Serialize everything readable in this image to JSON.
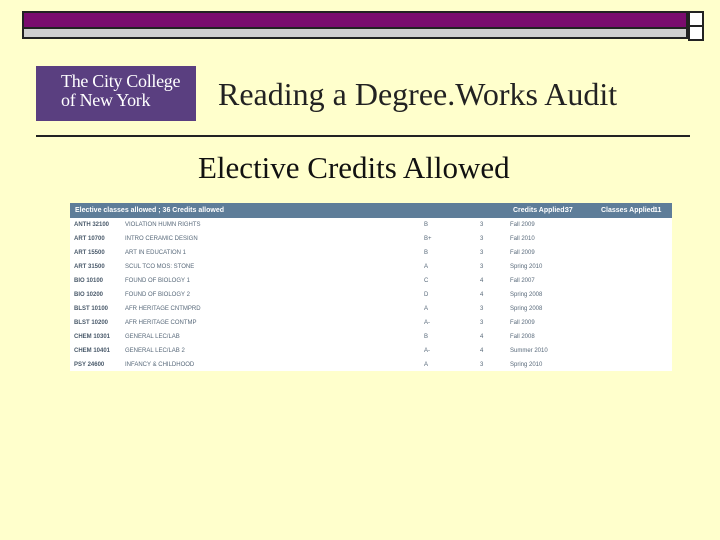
{
  "slide": {
    "title": "Reading a Degree.Works Audit",
    "subtitle": "Elective Credits Allowed"
  },
  "logo": {
    "line1": "The City College",
    "line2": "of New York"
  },
  "audit": {
    "header_label": "Elective classes allowed ; 36 Credits allowed",
    "credits_applied_label": "Credits Applied:",
    "credits_applied_value": "37",
    "classes_applied_label": "Classes Applied:",
    "classes_applied_value": "11",
    "rows": [
      {
        "course": "ANTH 32100",
        "title": "VIOLATION HUMN RIGHTS",
        "grade": "B",
        "credits": "3",
        "term": "Fall 2009"
      },
      {
        "course": "ART 10700",
        "title": "INTRO CERAMIC DESIGN",
        "grade": "B+",
        "credits": "3",
        "term": "Fall 2010"
      },
      {
        "course": "ART 15500",
        "title": "ART IN EDUCATION 1",
        "grade": "B",
        "credits": "3",
        "term": "Fall 2009"
      },
      {
        "course": "ART 31500",
        "title": "SCUL TCO MOS: STONE",
        "grade": "A",
        "credits": "3",
        "term": "Spring 2010"
      },
      {
        "course": "BIO 10100",
        "title": "FOUND OF BIOLOGY 1",
        "grade": "C",
        "credits": "4",
        "term": "Fall 2007"
      },
      {
        "course": "BIO 10200",
        "title": "FOUND OF BIOLOGY 2",
        "grade": "D",
        "credits": "4",
        "term": "Spring 2008"
      },
      {
        "course": "BLST 10100",
        "title": "AFR HERITAGE CNTMPRD",
        "grade": "A",
        "credits": "3",
        "term": "Spring 2008"
      },
      {
        "course": "BLST 10200",
        "title": "AFR HERITAGE CONTMP",
        "grade": "A-",
        "credits": "3",
        "term": "Fall 2009"
      },
      {
        "course": "CHEM 10301",
        "title": "GENERAL LEC/LAB",
        "grade": "B",
        "credits": "4",
        "term": "Fall 2008"
      },
      {
        "course": "CHEM 10401",
        "title": "GENERAL LEC/LAB 2",
        "grade": "A-",
        "credits": "4",
        "term": "Summer 2010"
      },
      {
        "course": "PSY 24600",
        "title": "INFANCY & CHILDHOOD",
        "grade": "A",
        "credits": "3",
        "term": "Spring 2010"
      }
    ]
  },
  "colors": {
    "background": "#ffffcc",
    "top_bar": "#7a0c6e",
    "logo_bg": "#5a3f80",
    "audit_header": "#5e7d99"
  }
}
